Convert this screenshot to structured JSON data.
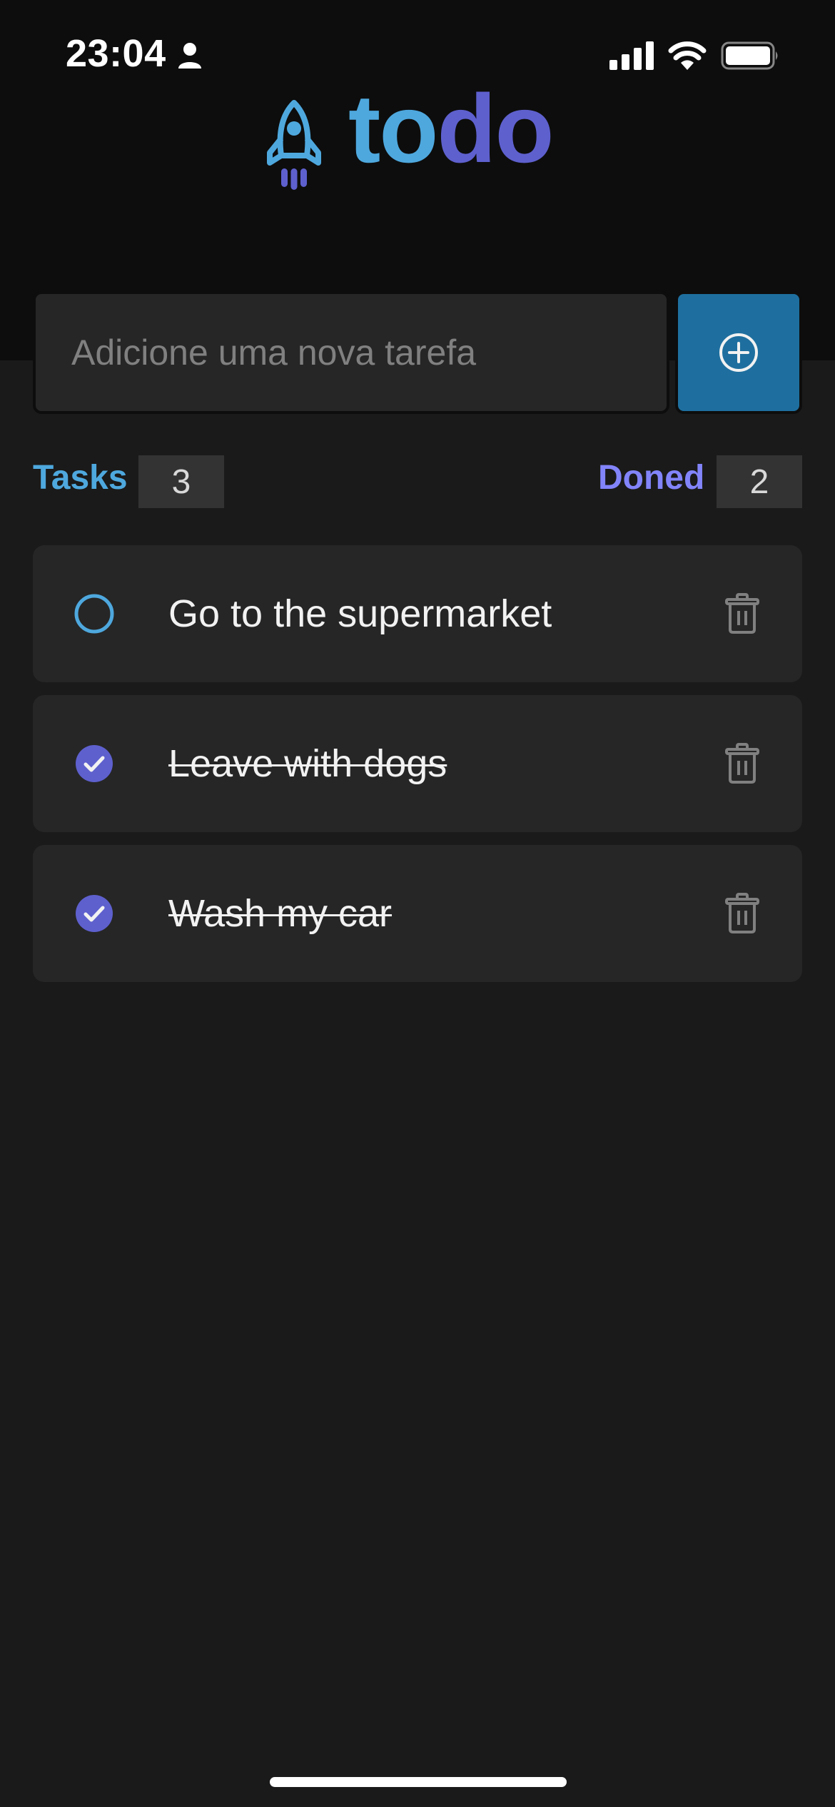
{
  "status_bar": {
    "time": "23:04",
    "icons": [
      "person-icon",
      "signal-icon",
      "wifi-icon",
      "battery-icon"
    ]
  },
  "logo": {
    "icon": "rocket-icon",
    "text_part1": "to",
    "text_part2": "do"
  },
  "new_task": {
    "placeholder": "Adicione uma nova tarefa",
    "value": "",
    "add_icon": "plus-circle-icon"
  },
  "counters": {
    "tasks_label": "Tasks",
    "tasks_count": "3",
    "done_label": "Doned",
    "done_count": "2"
  },
  "tasks": [
    {
      "text": "Go to the supermarket",
      "done": false
    },
    {
      "text": "Leave with dogs",
      "done": true
    },
    {
      "text": "Wash my car",
      "done": true
    }
  ],
  "colors": {
    "blue": "#4ea8de",
    "purple": "#5e60ce",
    "purple_light": "#8284fa",
    "button_blue": "#1e6f9f",
    "background": "#1a1a1a",
    "header": "#0d0d0d",
    "card": "#262626"
  }
}
